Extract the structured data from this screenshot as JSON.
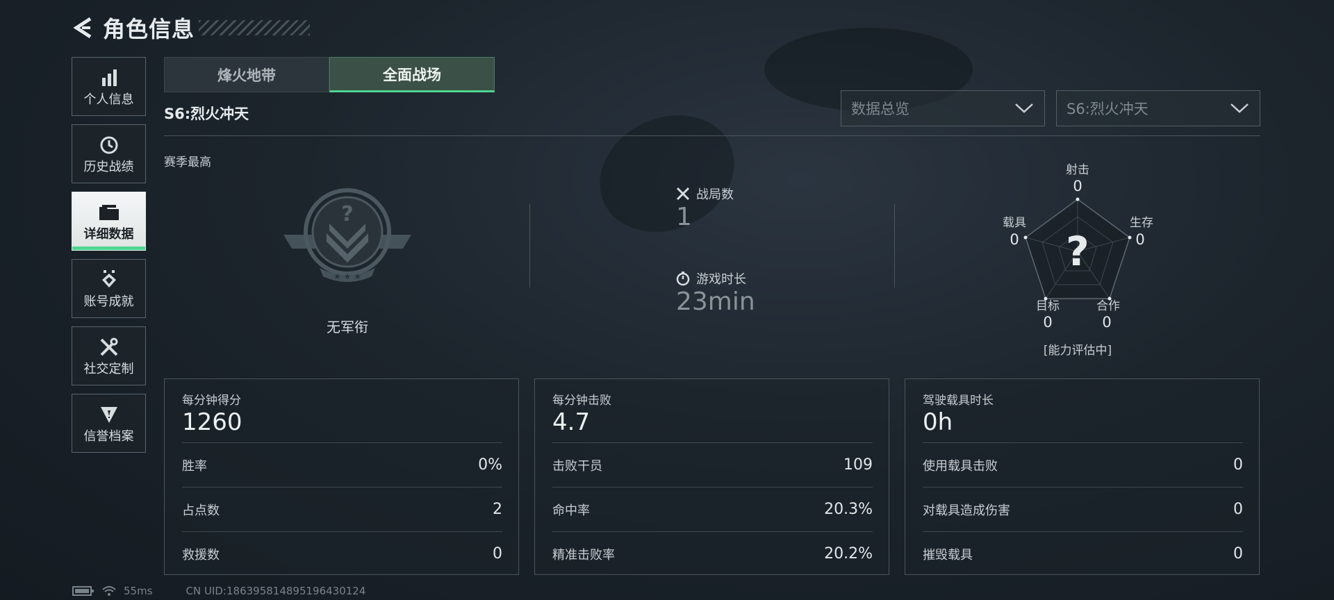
{
  "header": {
    "title": "角色信息"
  },
  "nav": [
    {
      "label": "个人信息",
      "icon": "bar-chart-icon"
    },
    {
      "label": "历史战绩",
      "icon": "history-icon"
    },
    {
      "label": "详细数据",
      "icon": "folder-icon",
      "active": true
    },
    {
      "label": "账号成就",
      "icon": "achievement-icon"
    },
    {
      "label": "社交定制",
      "icon": "tools-icon"
    },
    {
      "label": "信誉档案",
      "icon": "credit-badge-icon"
    }
  ],
  "tabs": [
    {
      "label": "烽火地带",
      "active": false
    },
    {
      "label": "全面战场",
      "active": true
    }
  ],
  "season_title": "S6:烈火冲天",
  "filters": {
    "data_select": "数据总览",
    "season_select": "S6:烈火冲天"
  },
  "season_best_label": "赛季最高",
  "rank": {
    "name": "无军衔"
  },
  "summary": {
    "matches_label": "战局数",
    "matches_value": "1",
    "playtime_label": "游戏时长",
    "playtime_value": "23min"
  },
  "radar": {
    "status": "[能力评估中]",
    "axes": [
      {
        "label": "射击",
        "value": "0"
      },
      {
        "label": "生存",
        "value": "0"
      },
      {
        "label": "合作",
        "value": "0"
      },
      {
        "label": "目标",
        "value": "0"
      },
      {
        "label": "载具",
        "value": "0"
      }
    ]
  },
  "cards": [
    {
      "title": "每分钟得分",
      "value": "1260",
      "rows": [
        {
          "label": "胜率",
          "value": "0%"
        },
        {
          "label": "占点数",
          "value": "2"
        },
        {
          "label": "救援数",
          "value": "0"
        }
      ]
    },
    {
      "title": "每分钟击败",
      "value": "4.7",
      "rows": [
        {
          "label": "击败干员",
          "value": "109"
        },
        {
          "label": "命中率",
          "value": "20.3%"
        },
        {
          "label": "精准击败率",
          "value": "20.2%"
        }
      ]
    },
    {
      "title": "驾驶载具时长",
      "value": "0h",
      "rows": [
        {
          "label": "使用载具击败",
          "value": "0"
        },
        {
          "label": "对载具造成伤害",
          "value": "0"
        },
        {
          "label": "摧毁载具",
          "value": "0"
        }
      ]
    }
  ],
  "footer": {
    "ping": "55ms",
    "uid": "CN UID:186395814895196430124"
  },
  "colors": {
    "accent_green": "#4ed690",
    "active_tab_bg": "#3b5046"
  }
}
